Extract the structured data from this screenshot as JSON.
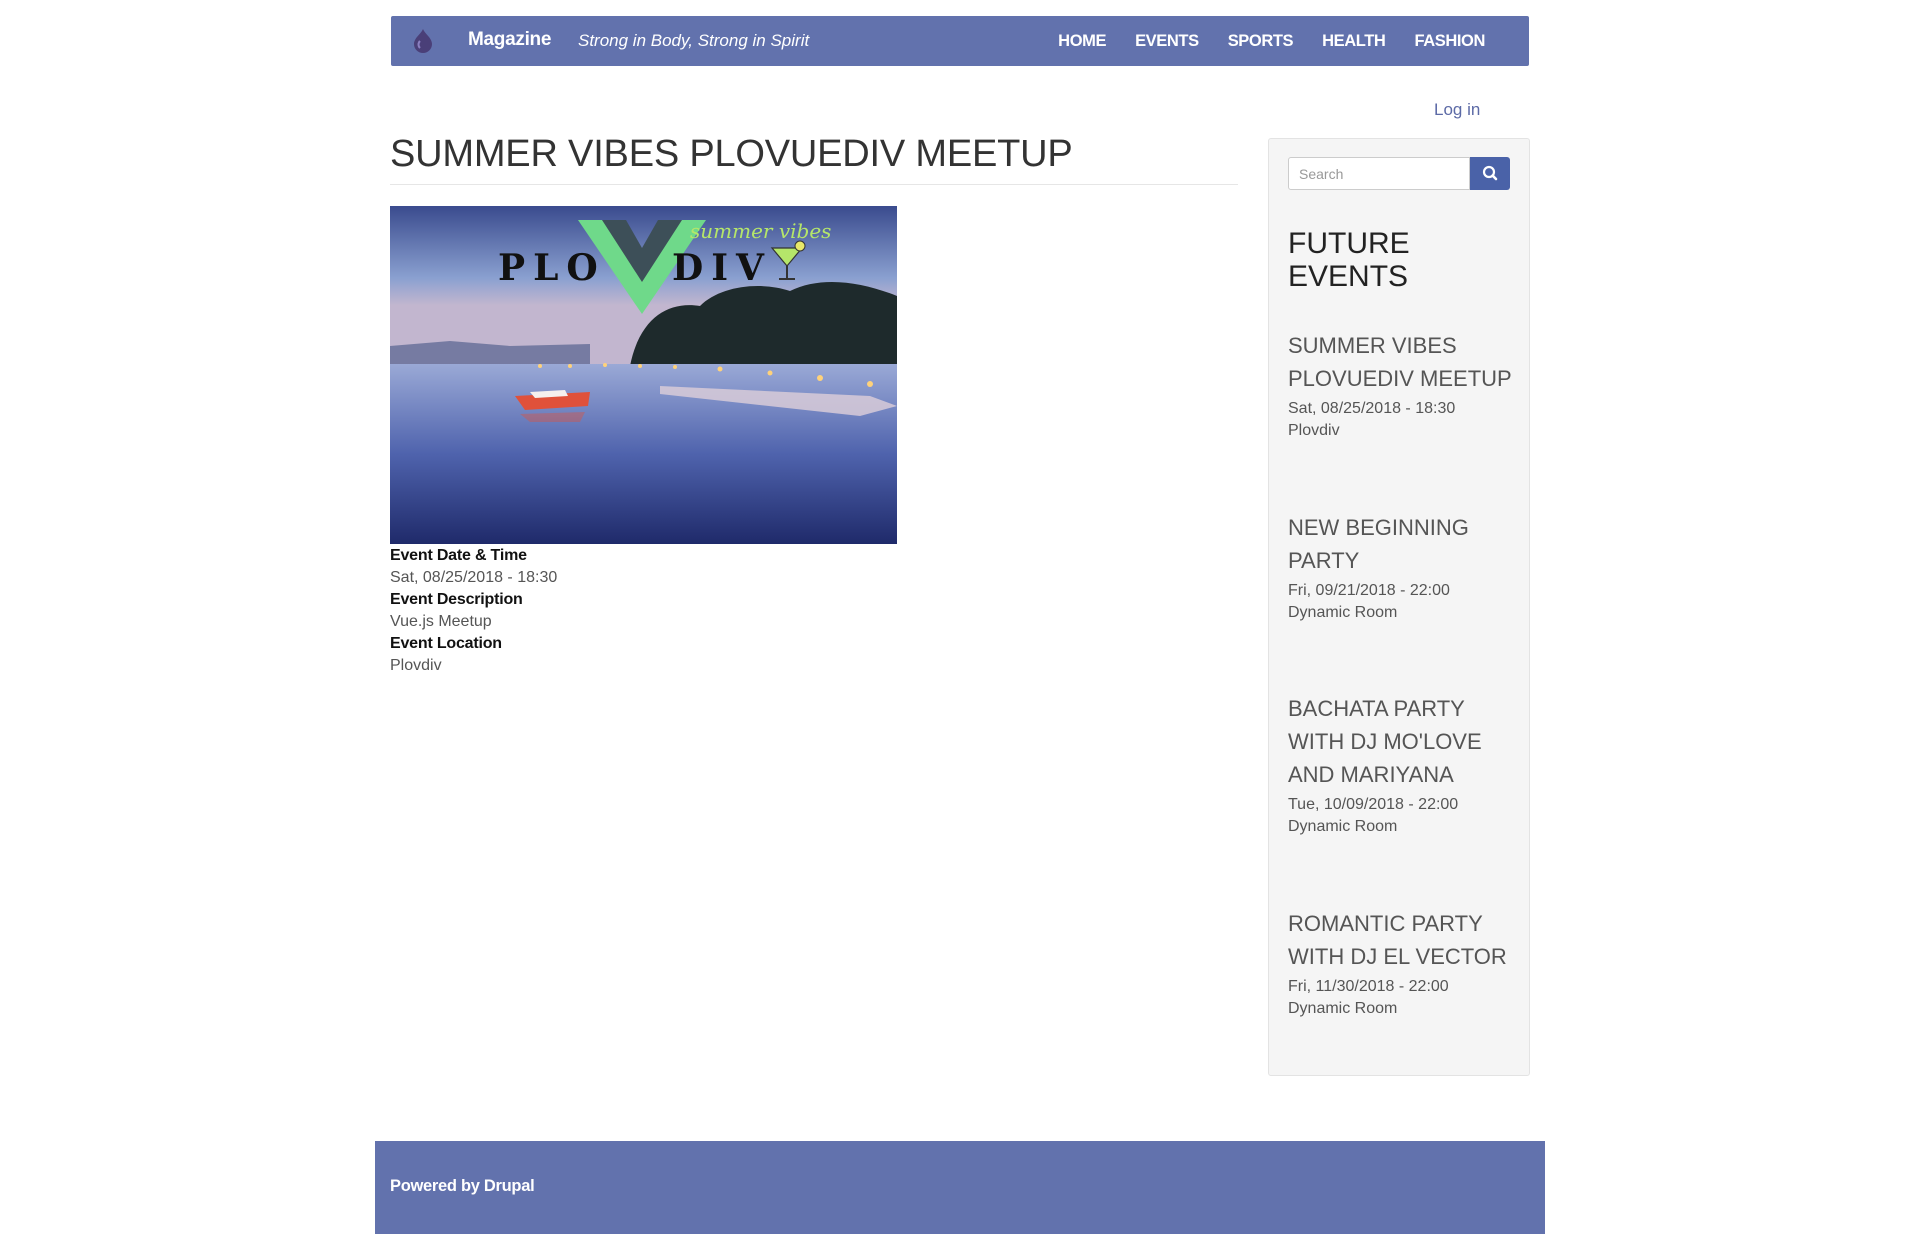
{
  "header": {
    "brand_name": "Magazine",
    "slogan": "Strong in Body, Strong in Spirit",
    "logo_icon": "drupal-drop-icon",
    "nav": [
      "HOME",
      "EVENTS",
      "SPORTS",
      "HEALTH",
      "FASHION"
    ]
  },
  "user": {
    "login_label": "Log in"
  },
  "event": {
    "title": "SUMMER VIBES PLOVUEDIV MEETUP",
    "image_banner": {
      "word_left": "PLO",
      "word_right": "DIV",
      "tagline": "summer vibes"
    },
    "fields": [
      {
        "label": "Event Date & Time",
        "value": "Sat, 08/25/2018 - 18:30"
      },
      {
        "label": "Event Description",
        "value": "Vue.js Meetup"
      },
      {
        "label": "Event Location",
        "value": "Plovdiv"
      }
    ]
  },
  "sidebar": {
    "search_placeholder": "Search",
    "search_icon": "search-icon",
    "future_events_title": "FUTURE EVENTS",
    "events": [
      {
        "title": "SUMMER VIBES PLOVUEDIV MEETUP",
        "date": "Sat, 08/25/2018 - 18:30",
        "location": "Plovdiv"
      },
      {
        "title": "NEW BEGINNING PARTY",
        "date": "Fri, 09/21/2018 - 22:00",
        "location": "Dynamic Room"
      },
      {
        "title": "BACHATA PARTY WITH DJ MO'LOVE AND MARIYANA",
        "date": "Tue, 10/09/2018 - 22:00",
        "location": "Dynamic Room"
      },
      {
        "title": "ROMANTIC PARTY WITH DJ EL VECTOR",
        "date": "Fri, 11/30/2018 - 22:00",
        "location": "Dynamic Room"
      }
    ]
  },
  "footer": {
    "powered_by": "Powered by Drupal"
  },
  "colors": {
    "brand": "#6272ad",
    "button": "#4a62a8",
    "link": "#5c6aa6"
  }
}
